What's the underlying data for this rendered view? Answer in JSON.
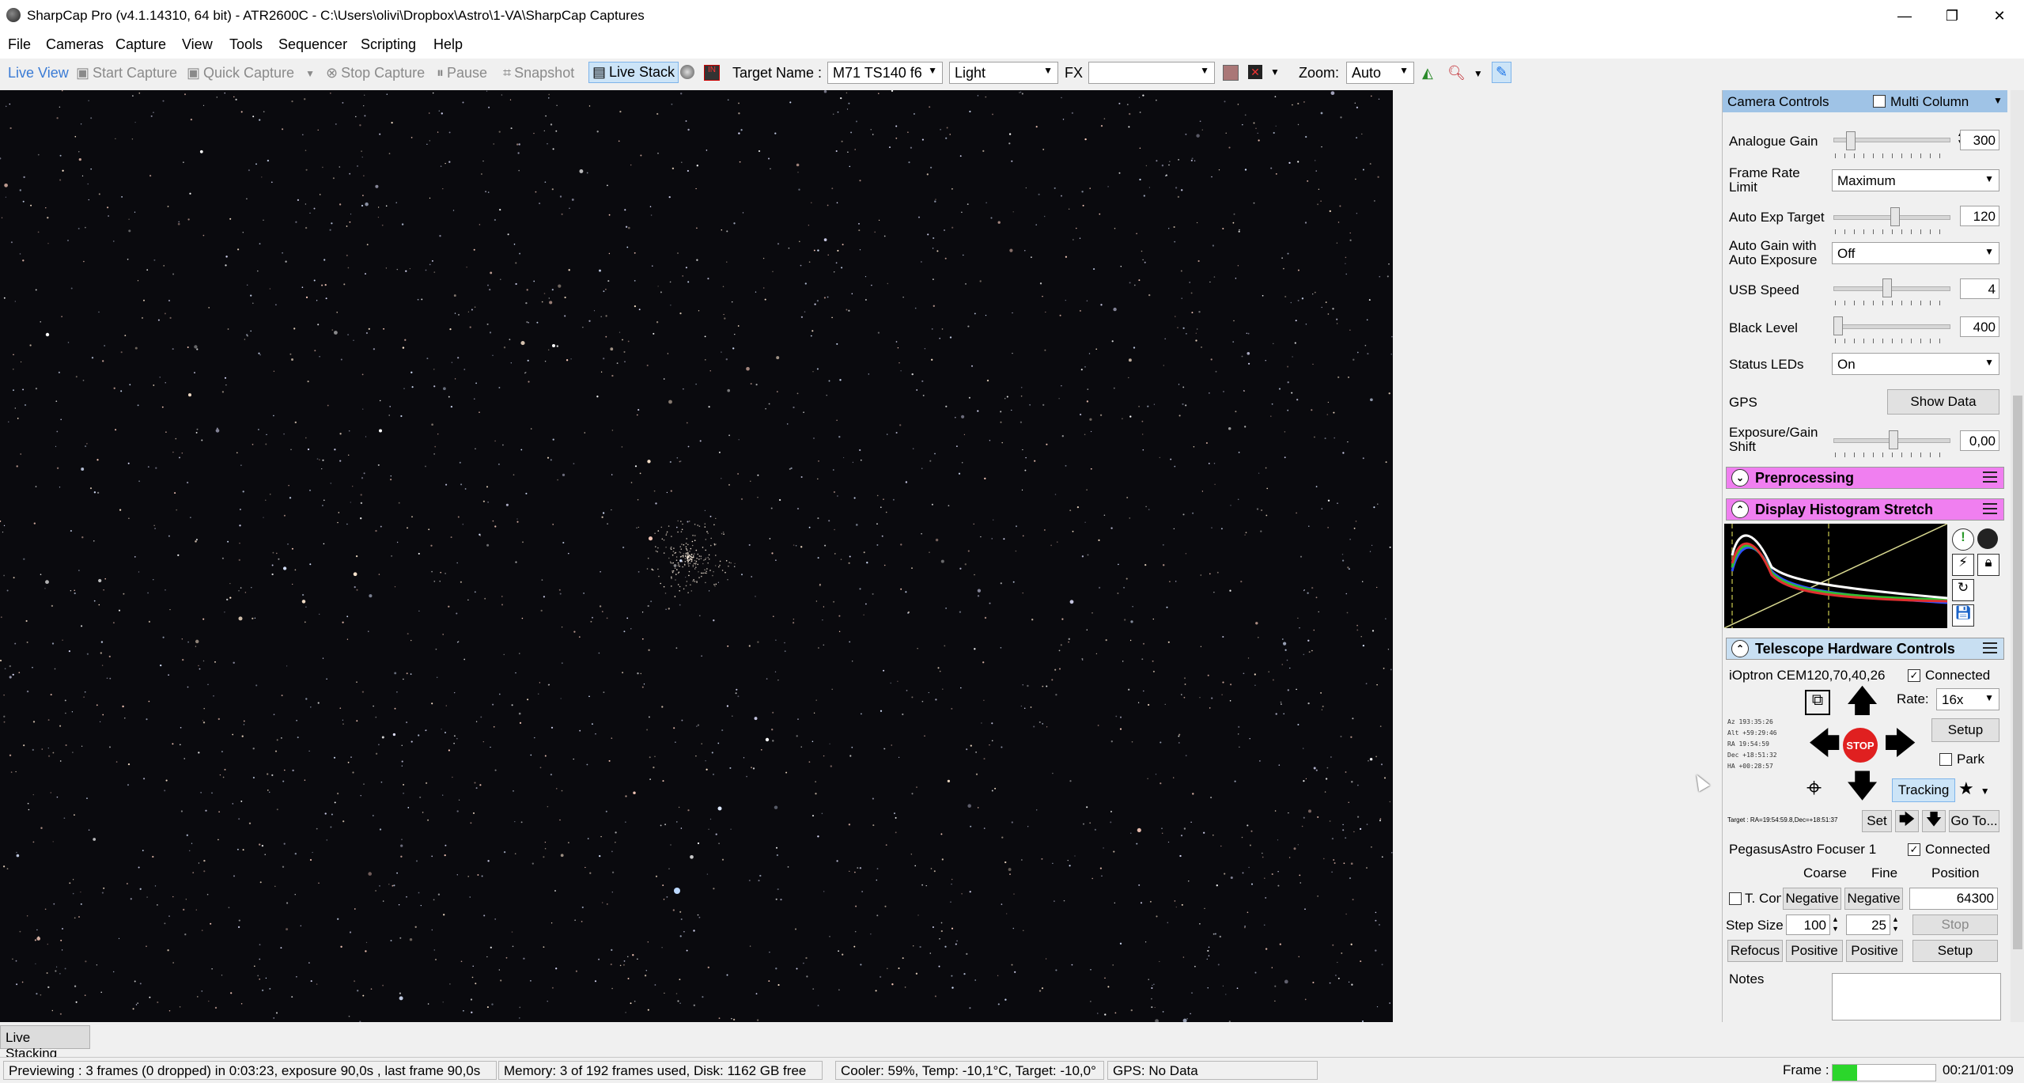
{
  "window": {
    "title": "SharpCap Pro (v4.1.14310, 64 bit) - ATR2600C - C:\\Users\\olivi\\Dropbox\\Astro\\1-VA\\SharpCap Captures",
    "minimize": "—",
    "maximize": "❐",
    "close": "✕"
  },
  "menu": [
    "File",
    "Cameras",
    "Capture",
    "View",
    "Tools",
    "Sequencer",
    "Scripting",
    "Help"
  ],
  "toolbar": {
    "live_view": "Live View",
    "start_capture": "Start Capture",
    "quick_capture": "Quick Capture",
    "stop_capture": "Stop Capture",
    "pause": "Pause",
    "snapshot": "Snapshot",
    "live_stack": "Live Stack",
    "target_name_label": "Target Name :",
    "target_name_value": "M71 TS140 f6",
    "frame_type": "Light",
    "fx_label": "FX",
    "fx_value": "",
    "zoom_label": "Zoom:",
    "zoom_value": "Auto"
  },
  "panel": {
    "title": "Camera Controls",
    "multi_column": "Multi Column",
    "controls": {
      "analogue_gain": {
        "label": "Analogue Gain",
        "value": "300"
      },
      "frame_rate": {
        "label": "Frame Rate Limit",
        "value": "Maximum"
      },
      "auto_exp_target": {
        "label": "Auto Exp Target",
        "value": "120"
      },
      "auto_gain": {
        "label": "Auto Gain with Auto Exposure",
        "value": "Off"
      },
      "usb_speed": {
        "label": "USB Speed",
        "value": "4"
      },
      "black_level": {
        "label": "Black Level",
        "value": "400"
      },
      "status_leds": {
        "label": "Status LEDs",
        "value": "On"
      },
      "gps": {
        "label": "GPS",
        "button": "Show Data"
      },
      "exposure_gain_shift": {
        "label": "Exposure/Gain Shift",
        "value": "0,00"
      }
    },
    "sections": {
      "preprocessing": "Preprocessing",
      "histogram": "Display Histogram Stretch",
      "telescope": "Telescope Hardware Controls"
    },
    "telescope": {
      "mount": "iOptron CEM120,70,40,26",
      "connected": "Connected",
      "rate_label": "Rate:",
      "rate_value": "16x",
      "setup": "Setup",
      "park": "Park",
      "tracking": "Tracking",
      "stop": "STOP",
      "set": "Set",
      "goto": "Go To...",
      "coords": [
        "Az  193:35:26",
        "Alt +59:29:46",
        "RA  19:54:59",
        "Dec +18:51:32",
        "HA  +00:28:57"
      ],
      "target": "Target : RA=19:54:59.8,Dec=+18:51:37"
    },
    "focuser": {
      "name": "PegasusAstro Focuser 1",
      "connected": "Connected",
      "coarse": "Coarse",
      "fine": "Fine",
      "position": "Position",
      "tcomp": "T. Con",
      "negative": "Negative",
      "positive": "Positive",
      "position_value": "64300",
      "step_size_label": "Step Size",
      "step_coarse": "100",
      "step_fine": "25",
      "stop": "Stop",
      "refocus": "Refocus",
      "setup": "Setup"
    },
    "notes_label": "Notes"
  },
  "tabs": {
    "live_stacking": "Live Stacking"
  },
  "status": {
    "preview": "Previewing : 3 frames (0 dropped) in 0:03:23, exposure 90,0s , last frame 90,0s",
    "memory": "Memory: 3 of 192 frames used, Disk: 1162 GB free",
    "cooler": "Cooler: 59%, Temp: -10,1°C, Target: -10,0°",
    "gps": "GPS: No Data",
    "frame_label": "Frame :",
    "time": "00:21/01:09"
  },
  "colors": {
    "section_pink": "#f07ff0",
    "panel_header": "#9fc3e6",
    "stop_red": "#e02020",
    "frame_progress": "#2bd62b"
  }
}
